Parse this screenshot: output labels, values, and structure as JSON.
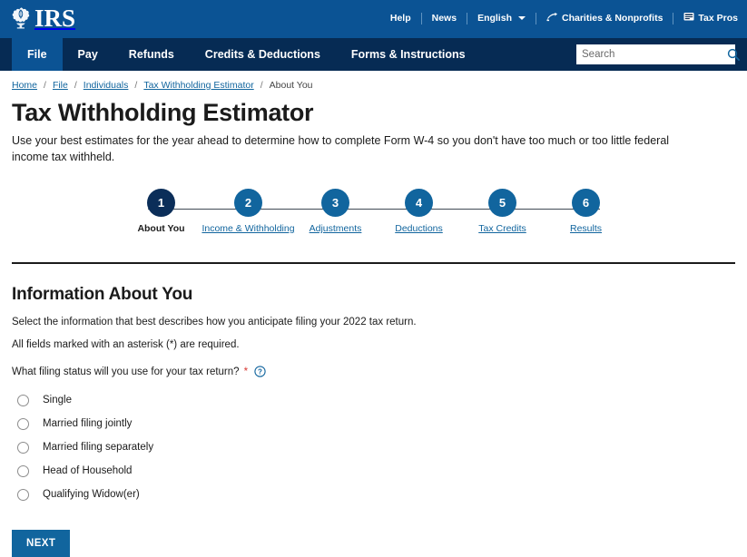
{
  "header": {
    "logo_text": "IRS",
    "logo_icon": "irs-eagle-scales-logo",
    "util_links": [
      {
        "label": "Help",
        "icon": null
      },
      {
        "label": "News",
        "icon": null
      },
      {
        "label": "English",
        "icon": "chevron-down-icon"
      },
      {
        "label": "Charities & Nonprofits",
        "icon": "charities-icon"
      },
      {
        "label": "Tax Pros",
        "icon": "tax-pros-icon"
      }
    ]
  },
  "nav": {
    "items": [
      {
        "label": "File",
        "active": true
      },
      {
        "label": "Pay",
        "active": false
      },
      {
        "label": "Refunds",
        "active": false
      },
      {
        "label": "Credits & Deductions",
        "active": false
      },
      {
        "label": "Forms & Instructions",
        "active": false
      }
    ]
  },
  "search": {
    "placeholder": "Search",
    "value": "",
    "icon": "search-icon"
  },
  "breadcrumb": {
    "items": [
      {
        "label": "Home",
        "link": true
      },
      {
        "label": "File",
        "link": true
      },
      {
        "label": "Individuals",
        "link": true
      },
      {
        "label": "Tax Withholding Estimator",
        "link": true
      },
      {
        "label": "About You",
        "link": false
      }
    ],
    "separator": "/"
  },
  "page": {
    "title": "Tax Withholding Estimator",
    "description": "Use your best estimates for the year ahead to determine how to complete Form W-4 so you don't have too much or too little federal income tax withheld."
  },
  "stepper": {
    "steps": [
      {
        "number": "1",
        "label": "About You",
        "current": true
      },
      {
        "number": "2",
        "label": "Income & Withholding",
        "current": false
      },
      {
        "number": "3",
        "label": "Adjustments",
        "current": false
      },
      {
        "number": "4",
        "label": "Deductions",
        "current": false
      },
      {
        "number": "5",
        "label": "Tax Credits",
        "current": false
      },
      {
        "number": "6",
        "label": "Results",
        "current": false
      }
    ]
  },
  "form": {
    "section_title": "Information About You",
    "intro_line_1": "Select the information that best describes how you anticipate filing your 2022 tax return.",
    "intro_line_2": "All fields marked with an asterisk (*) are required.",
    "question_label": "What filing status will you use for your tax return?",
    "question_required_marker": "*",
    "help_icon": "question-circle-icon",
    "options": [
      {
        "label": "Single",
        "selected": false
      },
      {
        "label": "Married filing jointly",
        "selected": false
      },
      {
        "label": "Married filing separately",
        "selected": false
      },
      {
        "label": "Head of Household",
        "selected": false
      },
      {
        "label": "Qualifying Widow(er)",
        "selected": false
      }
    ],
    "next_button": "NEXT"
  },
  "colors": {
    "header_blue": "#0b5394",
    "nav_navy": "#062b54",
    "link_blue": "#11659e",
    "current_step_navy": "#0b2e59",
    "required_red": "#d83933",
    "button_blue": "#11659e"
  }
}
